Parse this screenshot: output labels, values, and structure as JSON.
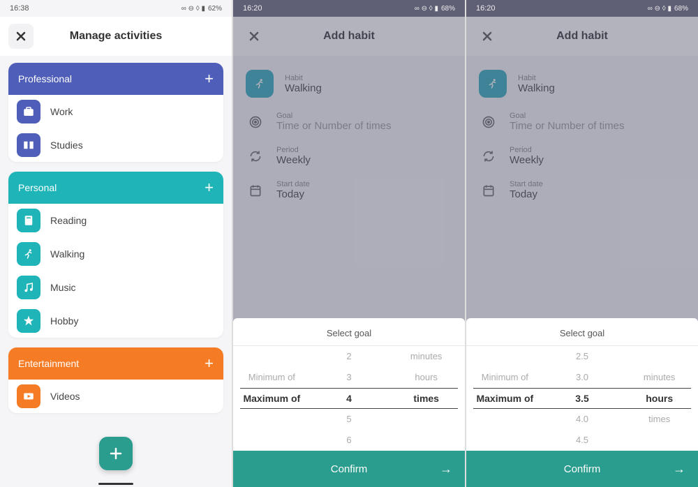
{
  "screen1": {
    "status": {
      "time": "16:38",
      "battery": "62%"
    },
    "title": "Manage activities",
    "categories": [
      {
        "name": "Professional",
        "cls": "cat-prof",
        "iconcls": "ic-prof",
        "items": [
          {
            "label": "Work",
            "icon": "briefcase-icon"
          },
          {
            "label": "Studies",
            "icon": "book-open-icon"
          }
        ]
      },
      {
        "name": "Personal",
        "cls": "cat-pers",
        "iconcls": "ic-pers",
        "items": [
          {
            "label": "Reading",
            "icon": "book-icon"
          },
          {
            "label": "Walking",
            "icon": "running-icon"
          },
          {
            "label": "Music",
            "icon": "music-icon"
          },
          {
            "label": "Hobby",
            "icon": "star-icon"
          }
        ]
      },
      {
        "name": "Entertainment",
        "cls": "cat-ent",
        "iconcls": "ic-ent",
        "items": [
          {
            "label": "Videos",
            "icon": "video-icon"
          }
        ]
      }
    ]
  },
  "screen2": {
    "status": {
      "time": "16:20",
      "battery": "68%"
    },
    "title": "Add habit",
    "habit": {
      "label": "Habit",
      "value": "Walking"
    },
    "goal": {
      "label": "Goal",
      "placeholder": "Time or Number of times"
    },
    "period": {
      "label": "Period",
      "value": "Weekly"
    },
    "start": {
      "label": "Start date",
      "value": "Today"
    },
    "sheet": {
      "title": "Select goal",
      "col1": [
        "",
        "Minimum of",
        "Maximum of",
        "",
        ""
      ],
      "col2": [
        "2",
        "3",
        "4",
        "5",
        "6"
      ],
      "col3": [
        "minutes",
        "hours",
        "times",
        "",
        ""
      ],
      "confirm": "Confirm"
    }
  },
  "screen3": {
    "status": {
      "time": "16:20",
      "battery": "68%"
    },
    "title": "Add habit",
    "habit": {
      "label": "Habit",
      "value": "Walking"
    },
    "goal": {
      "label": "Goal",
      "placeholder": "Time or Number of times"
    },
    "period": {
      "label": "Period",
      "value": "Weekly"
    },
    "start": {
      "label": "Start date",
      "value": "Today"
    },
    "sheet": {
      "title": "Select goal",
      "col1": [
        "",
        "Minimum of",
        "Maximum of",
        "",
        ""
      ],
      "col2": [
        "2.5",
        "3.0",
        "3.5",
        "4.0",
        "4.5"
      ],
      "col3": [
        "",
        "minutes",
        "hours",
        "times",
        ""
      ],
      "confirm": "Confirm"
    }
  }
}
